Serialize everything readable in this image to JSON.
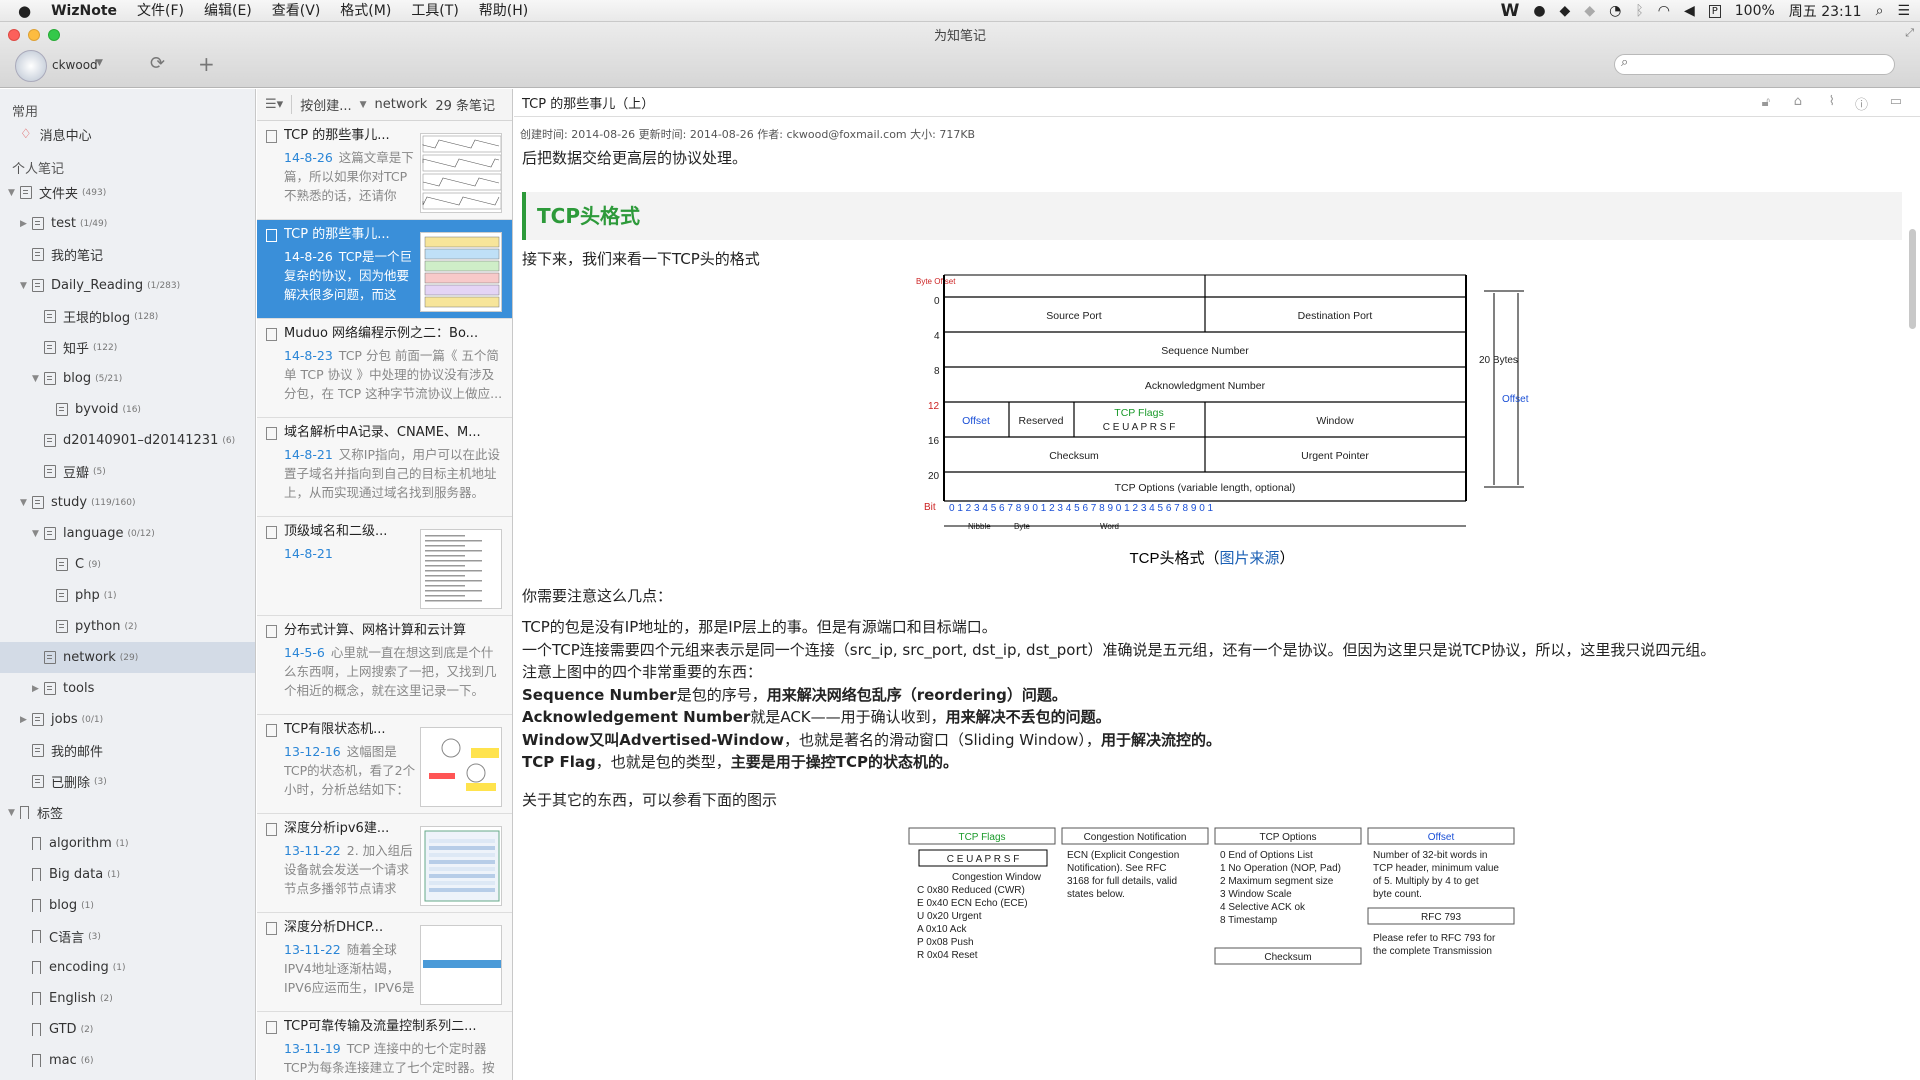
{
  "menubar": {
    "app": "WizNote",
    "items": [
      "文件(F)",
      "编辑(E)",
      "查看(V)",
      "格式(M)",
      "工具(T)",
      "帮助(H)"
    ],
    "battery": "100%",
    "clock": "周五 23:11"
  },
  "window": {
    "title": "为知笔记",
    "user": "ckwood"
  },
  "sidebar": {
    "common_label": "常用",
    "message_center": "消息中心",
    "personal_label": "个人笔记",
    "tree": [
      {
        "label": "文件夹",
        "count": "(493)",
        "indent": 0,
        "arrow": "▼",
        "icon": "f"
      },
      {
        "label": "test",
        "count": "(1/49)",
        "indent": 1,
        "arrow": "▶",
        "icon": "f"
      },
      {
        "label": "我的笔记",
        "count": "",
        "indent": 1,
        "arrow": "",
        "icon": "f"
      },
      {
        "label": "Daily_Reading",
        "count": "(1/283)",
        "indent": 1,
        "arrow": "▼",
        "icon": "f"
      },
      {
        "label": "王垠的blog",
        "count": "(128)",
        "indent": 2,
        "arrow": "",
        "icon": "f"
      },
      {
        "label": "知乎",
        "count": "(122)",
        "indent": 2,
        "arrow": "",
        "icon": "f"
      },
      {
        "label": "blog",
        "count": "(5/21)",
        "indent": 2,
        "arrow": "▼",
        "icon": "f"
      },
      {
        "label": "byvoid",
        "count": "(16)",
        "indent": 3,
        "arrow": "",
        "icon": "f"
      },
      {
        "label": "d20140901–d20141231",
        "count": "(6)",
        "indent": 2,
        "arrow": "",
        "icon": "f"
      },
      {
        "label": "豆瓣",
        "count": "(5)",
        "indent": 2,
        "arrow": "",
        "icon": "f"
      },
      {
        "label": "study",
        "count": "(119/160)",
        "indent": 1,
        "arrow": "▼",
        "icon": "f"
      },
      {
        "label": "language",
        "count": "(0/12)",
        "indent": 2,
        "arrow": "▼",
        "icon": "f"
      },
      {
        "label": "C",
        "count": "(9)",
        "indent": 3,
        "arrow": "",
        "icon": "f"
      },
      {
        "label": "php",
        "count": "(1)",
        "indent": 3,
        "arrow": "",
        "icon": "f"
      },
      {
        "label": "python",
        "count": "(2)",
        "indent": 3,
        "arrow": "",
        "icon": "f"
      },
      {
        "label": "network",
        "count": "(29)",
        "indent": 2,
        "arrow": "",
        "icon": "f",
        "selected": true
      },
      {
        "label": "tools",
        "count": "",
        "indent": 2,
        "arrow": "▶",
        "icon": "f"
      },
      {
        "label": "jobs",
        "count": "(0/1)",
        "indent": 1,
        "arrow": "▶",
        "icon": "f"
      },
      {
        "label": "我的邮件",
        "count": "",
        "indent": 1,
        "arrow": "",
        "icon": "f"
      },
      {
        "label": "已删除",
        "count": "(3)",
        "indent": 1,
        "arrow": "",
        "icon": "f"
      },
      {
        "label": "标签",
        "count": "",
        "indent": 0,
        "arrow": "▼",
        "icon": "t"
      },
      {
        "label": "algorithm",
        "count": "(1)",
        "indent": 1,
        "arrow": "",
        "icon": "t"
      },
      {
        "label": "Big data",
        "count": "(1)",
        "indent": 1,
        "arrow": "",
        "icon": "t"
      },
      {
        "label": "blog",
        "count": "(1)",
        "indent": 1,
        "arrow": "",
        "icon": "t"
      },
      {
        "label": "C语言",
        "count": "(3)",
        "indent": 1,
        "arrow": "",
        "icon": "t"
      },
      {
        "label": "encoding",
        "count": "(1)",
        "indent": 1,
        "arrow": "",
        "icon": "t"
      },
      {
        "label": "English",
        "count": "(2)",
        "indent": 1,
        "arrow": "",
        "icon": "t"
      },
      {
        "label": "GTD",
        "count": "(2)",
        "indent": 1,
        "arrow": "",
        "icon": "t"
      },
      {
        "label": "mac",
        "count": "(6)",
        "indent": 1,
        "arrow": "",
        "icon": "t"
      }
    ]
  },
  "notelist": {
    "sort": "按创建...",
    "folder": "network",
    "count": "29 条笔记",
    "notes": [
      {
        "title": "TCP 的那些事儿...",
        "date": "14-8-26",
        "snippet": "这篇文章是下篇，所以如果你对TCP不熟悉的话，还请你先...",
        "thumb": "chart"
      },
      {
        "title": "TCP 的那些事儿...",
        "date": "14-8-26",
        "snippet": "TCP是一个巨复杂的协议，因为他要解决很多问题，而这些...",
        "thumb": "tcp",
        "selected": true
      },
      {
        "title": "Muduo 网络编程示例之二：Bo...",
        "date": "14-8-23",
        "snippet": "TCP 分包 前面一篇《 五个简单 TCP 协议 》中处理的协议没有涉及分包，在 TCP 这种字节流协议上做应...",
        "thumb": ""
      },
      {
        "title": "域名解析中A记录、CNAME、M...",
        "date": "14-8-21",
        "snippet": "又称IP指向，用户可以在此设置子域名并指向到自己的目标主机地址上，从而实现通过域名找到服务器。 说...",
        "thumb": ""
      },
      {
        "title": "顶级域名和二级...",
        "date": "14-8-21",
        "snippet": "",
        "thumb": "text"
      },
      {
        "title": "分布式计算、网格计算和云计算",
        "date": "14-5-6",
        "snippet": "心里就一直在想这到底是个什么东西啊，上网搜索了一把，又找到几个相近的概念，就在这里记录一下。 1...",
        "thumb": ""
      },
      {
        "title": "TCP有限状态机...",
        "date": "13-12-16",
        "snippet": "这幅图是TCP的状态机，看了2个小时，分析总结如下： (...",
        "thumb": "fsm"
      },
      {
        "title": "深度分析ipv6建...",
        "date": "13-11-22",
        "snippet": "2. 加入组后设备就会发送一个请求节点多播邻节点请求报...",
        "thumb": "win"
      },
      {
        "title": "深度分析DHCP...",
        "date": "13-11-22",
        "snippet": "随着全球IPV4地址逐渐枯竭，IPV6应运而生，IPV6是将来...",
        "thumb": "bar"
      },
      {
        "title": "TCP可靠传输及流量控制系列二...",
        "date": "13-11-19",
        "snippet": "TCP 连接中的七个定时器 TCP为每条连接建立了七个定时器。按照",
        "thumb": ""
      }
    ]
  },
  "note": {
    "title": "TCP 的那些事儿（上）",
    "meta": "创建时间: 2014-08-26    更新时间: 2014-08-26    作者: ckwood@foxmail.com    大小: 717KB",
    "p_top": "后把数据交给更高层的协议处理。",
    "heading": "TCP头格式",
    "p_intro": "接下来，我们来看一下TCP头的格式",
    "caption_pre": "TCP头格式（",
    "caption_link": "图片来源",
    "caption_post": "）",
    "p_notice": "你需要注意这么几点：",
    "l1": "TCP的包是没有IP地址的，那是IP层上的事。但是有源端口和目标端口。",
    "l2": "一个TCP连接需要四个元组来表示是同一个连接（src_ip, src_port, dst_ip, dst_port）准确说是五元组，还有一个是协议。但因为这里只是说TCP协议，所以，这里我只说四元组。",
    "l3": "注意上图中的四个非常重要的东西：",
    "seq_a": "Sequence Number",
    "seq_b": "是包的序号，",
    "seq_c": "用来解决网络包乱序（reordering）问题。",
    "ack_a": "Acknowledgement Number",
    "ack_b": "就是ACK——用于确认收到，",
    "ack_c": "用来解决不丢包的问题。",
    "win_a": "Window又叫Advertised-Window",
    "win_b": "，也就是著名的滑动窗口（Sliding Window），",
    "win_c": "用于解决流控的。",
    "flag_a": "TCP Flag",
    "flag_b": "，也就是包的类型，",
    "flag_c": "主要是用于操控TCP的状态机的。",
    "p_other": "关于其它的东西，可以参看下面的图示"
  },
  "diagram": {
    "byte_offset": "Byte Offset",
    "rows": [
      "0",
      "4",
      "8",
      "12",
      "16",
      "20"
    ],
    "src": "Source Port",
    "dst": "Destination Port",
    "seq": "Sequence Number",
    "ack": "Acknowledgment Number",
    "offset": "Offset",
    "reserved": "Reserved",
    "flags": "TCP Flags",
    "flag_letters": "C E U A P R S F",
    "window": "Window",
    "checksum": "Checksum",
    "urgent": "Urgent Pointer",
    "options": "TCP Options (variable length, optional)",
    "bytes20": "20 Bytes",
    "bit": "Bit",
    "nibble": "Nibble",
    "byte": "Byte",
    "word": "Word"
  },
  "legend": {
    "flags_title": "TCP Flags",
    "flags_letters": "C E U A P R S F",
    "cw": "Congestion Window",
    "flag_lines": [
      "C  0x80 Reduced (CWR)",
      "E  0x40 ECN Echo (ECE)",
      "U  0x20 Urgent",
      "A  0x10 Ack",
      "P  0x08 Push",
      "R  0x04 Reset"
    ],
    "cn_title": "Congestion Notification",
    "cn_text": [
      "ECN (Explicit Congestion",
      "Notification).  See RFC",
      "3168 for full details, valid",
      "states below."
    ],
    "opt_title": "TCP Options",
    "opt_lines": [
      "0 End of Options List",
      "1 No Operation (NOP, Pad)",
      "2 Maximum segment size",
      "3 Window Scale",
      "4 Selective ACK ok",
      "8 Timestamp"
    ],
    "checksum_title": "Checksum",
    "off_title": "Offset",
    "off_text": [
      "Number of 32-bit words in",
      "TCP header, minimum value",
      "of 5.  Multiply by 4 to get",
      "byte count."
    ],
    "rfc_title": "RFC 793",
    "rfc_text": [
      "Please refer to RFC 793 for",
      "the complete Transmission"
    ]
  }
}
